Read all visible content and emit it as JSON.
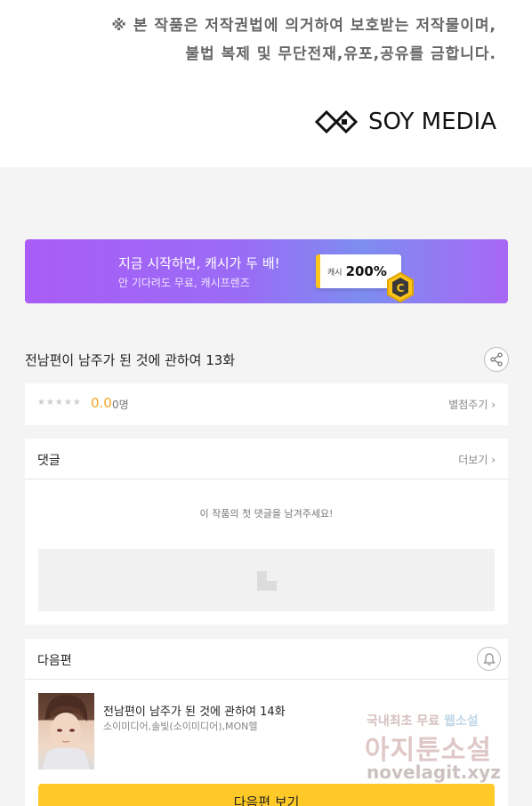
{
  "notice": {
    "line1": "※ 본 작품은 저작권법에 의거하여 보호받는 저작물이며,",
    "line2": "불법 복제 및 무단전재,유포,공유를 금합니다.",
    "logo_text": "SOY MEDIA"
  },
  "banner": {
    "title": "지금 시작하면, 캐시가 두 배!",
    "subtitle": "안 기다려도 무료, 캐시프렌즈",
    "cash_label": "캐시",
    "cash_percent": "200%",
    "coin_letter": "C"
  },
  "episode": {
    "title": "전남편이 남주가 된 것에 관하여 13화"
  },
  "rating": {
    "stars": "★★★★★",
    "score": "0.0",
    "count": "0명",
    "rate_link": "별점주기 ›"
  },
  "comments": {
    "title": "댓글",
    "more": "더보기 ›",
    "empty": "이 작품의 첫 댓글을 남겨주세요!"
  },
  "next": {
    "section_title": "다음편",
    "title": "전남편이 남주가 된 것에 관하여 14화",
    "author": "소이미디어,솔빛(소이미디어),MON헬",
    "button": "다음편 보기"
  },
  "watermark": {
    "line1_a": "국내최초 무료 ",
    "line1_b": "웹소설",
    "line2": "아지툰소설",
    "line3": "novelagit.xyz"
  },
  "colors": {
    "accent": "#ffca28",
    "score": "#f5a623",
    "banner_start": "#a95cf7"
  },
  "icons": [
    "soy-media-logo",
    "share-icon",
    "bell-icon",
    "coin-icon",
    "ad-placeholder-icon"
  ]
}
